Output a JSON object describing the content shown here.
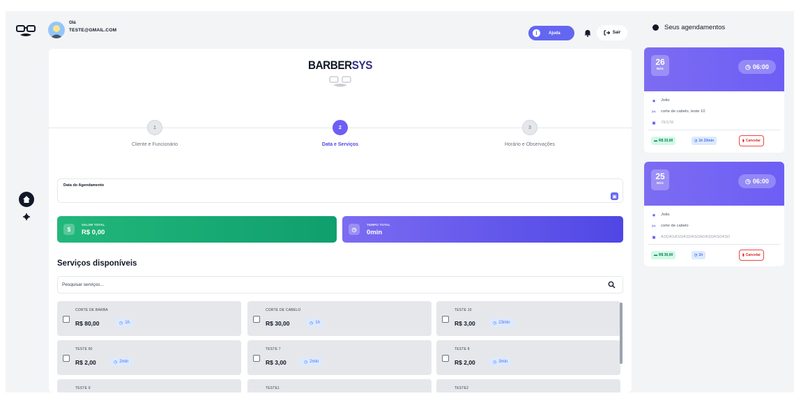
{
  "user": {
    "greeting": "Olá",
    "email": "TESTE@GMAIL.COM"
  },
  "header": {
    "help_label": "Ajuda",
    "exit_label": "Sair"
  },
  "brand": {
    "part1": "BARBER",
    "part2": "SYS"
  },
  "steps": [
    {
      "number": "1",
      "label": "Cliente e Funcionário",
      "active": false
    },
    {
      "number": "2",
      "label": "Data e Serviços",
      "active": true
    },
    {
      "number": "3",
      "label": "Horário e Observações",
      "active": false
    }
  ],
  "date_field": {
    "label": "Data do Agendamento",
    "value": ""
  },
  "totals": {
    "value_label": "VALOR TOTAL",
    "value": "R$ 0,00",
    "time_label": "TEMPO TOTAL",
    "time": "0min"
  },
  "services": {
    "title": "Serviços disponíveis",
    "search_placeholder": "Pesquisar serviços...",
    "items": [
      {
        "name": "CORTE DE BARBA",
        "price": "R$ 80,00",
        "duration": "1h"
      },
      {
        "name": "CORTE DE CABELO",
        "price": "R$ 30,00",
        "duration": "1h"
      },
      {
        "name": "TESTE 10",
        "price": "R$ 3,00",
        "duration": "23min"
      },
      {
        "name": "TESTE 60",
        "price": "R$ 2,00",
        "duration": "2min"
      },
      {
        "name": "TESTE 7",
        "price": "R$ 3,00",
        "duration": "2min"
      },
      {
        "name": "TESTE 8",
        "price": "R$ 2,00",
        "duration": "3min"
      },
      {
        "name": "TESTE 9",
        "price": "",
        "duration": ""
      },
      {
        "name": "TESTE1",
        "price": "",
        "duration": ""
      },
      {
        "name": "TESTE2",
        "price": "",
        "duration": ""
      }
    ]
  },
  "appointments": {
    "title": "Seus agendamentos",
    "items": [
      {
        "day": "26",
        "month": "NOV.",
        "time": "06:00",
        "client": "João",
        "services": "corte de cabelo, teste 10",
        "notes": "TESTE",
        "price": "R$ 33,00",
        "duration": "1h 23min",
        "cancel_label": "Cancelar"
      },
      {
        "day": "25",
        "month": "NOV.",
        "time": "06:00",
        "client": "João",
        "services": "corte de cabelo",
        "notes": "ASDASASDASDASDADASDASDASD",
        "price": "R$ 30,00",
        "duration": "1h",
        "cancel_label": "Cancelar"
      }
    ]
  },
  "colors": {
    "accent": "#6366f1",
    "green": "#10b981",
    "danger": "#ef4444"
  }
}
